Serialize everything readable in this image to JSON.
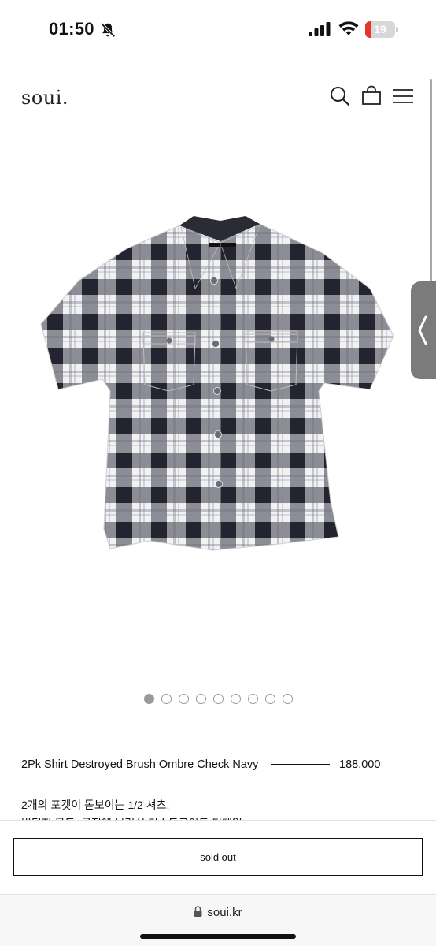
{
  "status_bar": {
    "time": "01:50",
    "battery_level": "19",
    "icons": [
      "bell-slash-icon",
      "cellular-signal-icon",
      "wifi-icon",
      "battery-icon"
    ]
  },
  "header": {
    "logo": "soui.",
    "icons": [
      "search-icon",
      "shopping-bag-icon",
      "hamburger-menu-icon"
    ]
  },
  "gallery": {
    "image_count": 9,
    "active_index": 0,
    "side_tab_icon": "chevron-left-icon"
  },
  "product": {
    "name": "2Pk Shirt Destroyed Brush Ombre Check Navy",
    "price": "188,000",
    "description_lines": [
      "2개의 포켓이 돋보이는 1/2 셔츠.",
      "빈티지 무드, 공정에 브러쉬 디스트로이드 디테일"
    ]
  },
  "actions": {
    "sold_out_label": "sold out"
  },
  "browser": {
    "address": "soui.kr"
  }
}
